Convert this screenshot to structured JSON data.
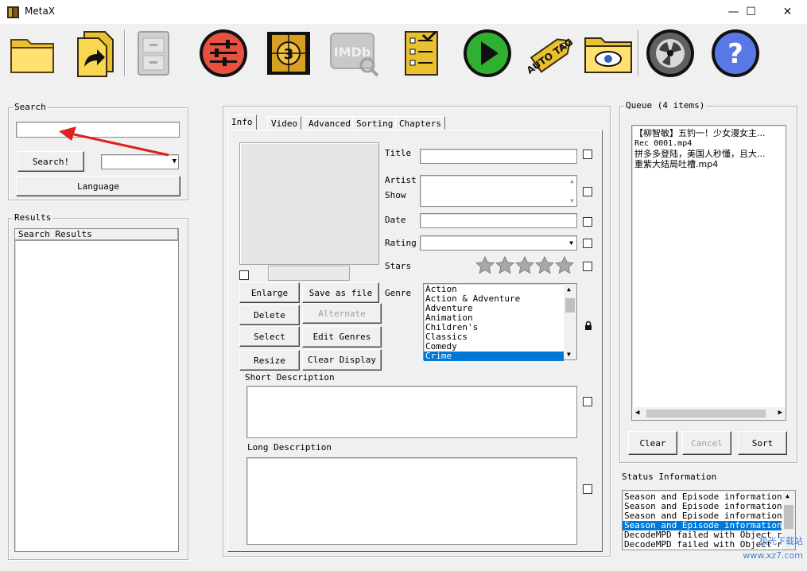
{
  "window": {
    "title": "MetaX",
    "minimize": "—",
    "maximize": "☐",
    "close": "✕"
  },
  "toolbar": {
    "buttons": [
      "open-folder-icon",
      "load-file-icon",
      "cabinet-icon",
      "settings-sliders-icon",
      "countdown-film-icon",
      "imdb-search-icon",
      "checklist-icon",
      "play-icon",
      "auto-tag-icon",
      "view-folder-icon",
      "reel-icon",
      "help-icon"
    ],
    "imdb_label": "IMDb",
    "auto_tag_label": "AUTO TAG"
  },
  "search": {
    "legend": "Search",
    "input_value": "",
    "search_button": "Search!",
    "source_select": "",
    "language_button": "Language"
  },
  "results": {
    "legend": "Results",
    "column_header": "Search Results"
  },
  "tabs": [
    "Info",
    "Video",
    "Advanced",
    "Sorting",
    "Chapters"
  ],
  "info": {
    "title_label": "Title",
    "artist_label": "Artist",
    "show_label": "Show",
    "date_label": "Date",
    "rating_label": "Rating",
    "stars_label": "Stars",
    "genre_label": "Genre",
    "stars_value": 0,
    "genres": [
      "Action",
      "Action & Adventure",
      "Adventure",
      "Animation",
      "Children's",
      "Classics",
      "Comedy",
      "Crime"
    ],
    "selected_genre": "Crime",
    "short_desc_label": "Short Description",
    "long_desc_label": "Long Description",
    "buttons": {
      "enlarge": "Enlarge",
      "save_as_file": "Save as file",
      "delete": "Delete",
      "alternate": "Alternate",
      "select": "Select",
      "edit_genres": "Edit Genres",
      "resize": "Resize",
      "clear_display": "Clear Display"
    }
  },
  "queue": {
    "legend": "Queue (4 items)",
    "items": [
      "【柳智敏】五钓一！少女漫女主...",
      "Rec 0001.mp4",
      "拼多多登陆，美国人秒懂，且大...",
      "重紫大结局吐槽.mp4"
    ],
    "clear_button": "Clear",
    "cancel_button": "Cancel",
    "sort_button": "Sort"
  },
  "status": {
    "legend": "Status Information",
    "lines": [
      "Season and Episode information al",
      "Season and Episode information al",
      "Season and Episode information al",
      "Season and Episode information al",
      "DecodeMPD failed with Object refe",
      "DecodeMPD failed with Object refe"
    ],
    "selected_index": 3
  },
  "watermark": "极光下载站 www.xz7.com"
}
